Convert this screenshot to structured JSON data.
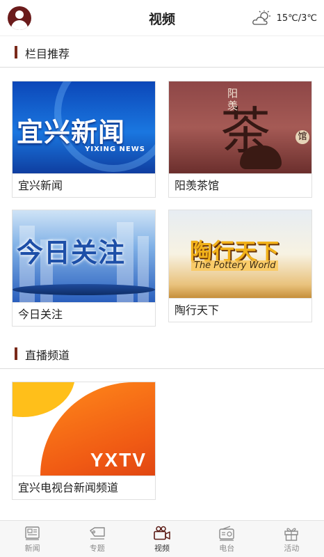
{
  "header": {
    "title": "视频",
    "avatar_icon": "user-avatar-icon",
    "weather": {
      "icon": "partly-sunny-icon",
      "text": "15℃/3℃"
    }
  },
  "sections": {
    "recommended": {
      "label": "栏目推荐"
    },
    "live": {
      "label": "直播频道"
    }
  },
  "programs": [
    {
      "title": "宜兴新闻",
      "thumb_text": "宜兴新闻",
      "thumb_sub": "YIXING NEWS"
    },
    {
      "title": "阳羡茶馆",
      "thumb_text": "茶",
      "thumb_v1": "阳\n羡",
      "thumb_v2": "馆"
    },
    {
      "title": "今日关注",
      "thumb_text": "今日关注"
    },
    {
      "title": "陶行天下",
      "thumb_text": "陶行天下",
      "thumb_sub": "The Pottery World"
    }
  ],
  "channels": [
    {
      "title": "宜兴电视台新闻频道",
      "logo": "YXTV"
    }
  ],
  "bottom_nav": [
    {
      "label": "新闻",
      "icon": "newspaper-icon",
      "active": false
    },
    {
      "label": "专题",
      "icon": "tag-icon",
      "active": false
    },
    {
      "label": "视频",
      "icon": "video-camera-icon",
      "active": true
    },
    {
      "label": "电台",
      "icon": "radio-icon",
      "active": false
    },
    {
      "label": "活动",
      "icon": "gift-icon",
      "active": false
    }
  ],
  "colors": {
    "accent": "#7a2a1a",
    "active_icon": "#6b1b1b",
    "inactive": "#8a8a8a"
  }
}
